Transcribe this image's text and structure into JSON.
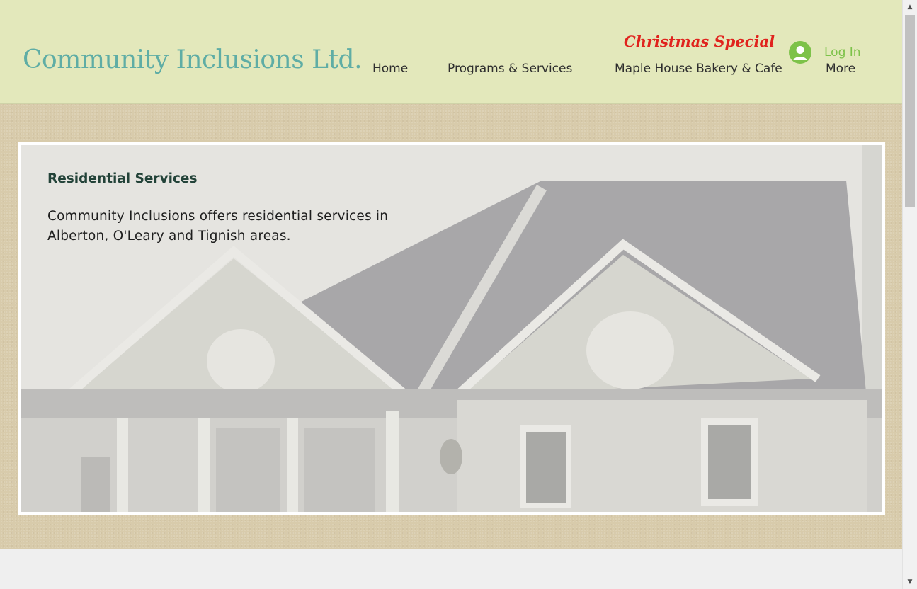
{
  "header": {
    "site_title": "Community Inclusions Ltd.",
    "promo": "Christmas Special",
    "login_label": "Log In",
    "nav": [
      "Home",
      "Programs & Services",
      "Maple House Bakery & Cafe",
      "More"
    ]
  },
  "main": {
    "heading": "Residential Services",
    "body": "Community Inclusions offers residential services in Alberton, O'Leary and Tignish areas.",
    "image": "house-photo"
  },
  "colors": {
    "header_bg": "#e3e8bb",
    "title": "#5fada5",
    "promo": "#e0231d",
    "login": "#7dc249",
    "band_bg": "#d8cbab",
    "heading": "#234339"
  },
  "icons": {
    "login": "user-avatar-icon",
    "scroll_up": "scroll-up-arrow-icon",
    "scroll_down": "scroll-down-arrow-icon"
  }
}
